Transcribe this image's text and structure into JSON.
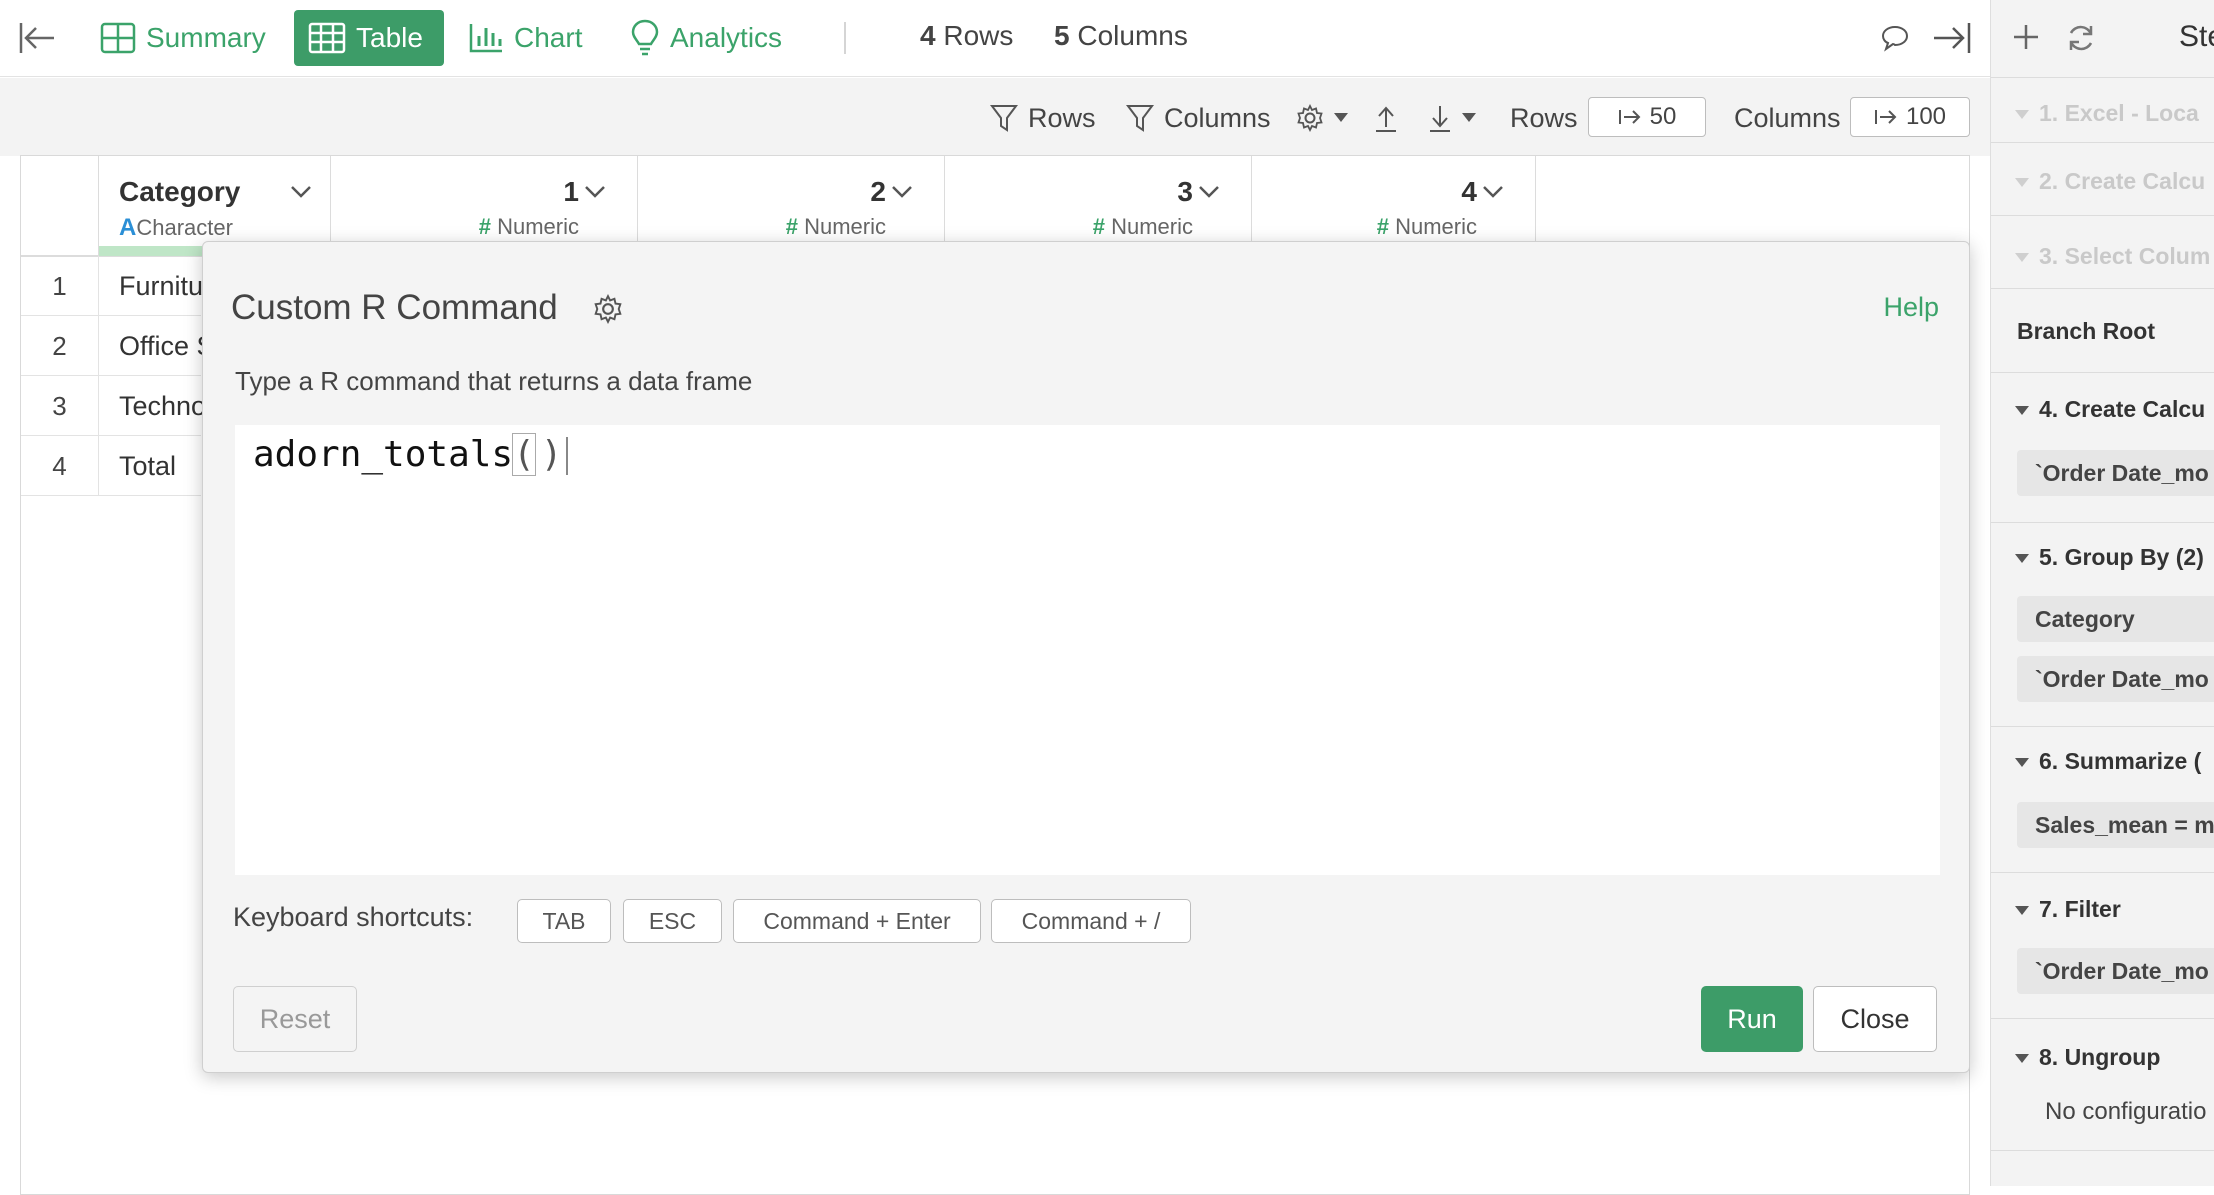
{
  "topbar": {
    "tabs": [
      {
        "label": "Summary",
        "icon": "summary-icon"
      },
      {
        "label": "Table",
        "icon": "table-icon",
        "active": true
      },
      {
        "label": "Chart",
        "icon": "chart-icon"
      },
      {
        "label": "Analytics",
        "icon": "bulb-icon"
      }
    ],
    "rows_count": "4",
    "rows_label": "Rows",
    "cols_count": "5",
    "cols_label": "Columns"
  },
  "toolbar": {
    "rows_filter": "Rows",
    "columns_filter": "Columns",
    "rows_label": "Rows",
    "rows_value": "50",
    "columns_label": "Columns",
    "columns_value": "100"
  },
  "table": {
    "columns": [
      {
        "name": "Category",
        "type": "Character",
        "type_icon": "A"
      },
      {
        "name": "1",
        "type": "Numeric",
        "type_icon": "#"
      },
      {
        "name": "2",
        "type": "Numeric",
        "type_icon": "#"
      },
      {
        "name": "3",
        "type": "Numeric",
        "type_icon": "#"
      },
      {
        "name": "4",
        "type": "Numeric",
        "type_icon": "#"
      }
    ],
    "rows": [
      {
        "num": "1",
        "category": "Furnitu"
      },
      {
        "num": "2",
        "category": "Office S"
      },
      {
        "num": "3",
        "category": "Techno"
      },
      {
        "num": "4",
        "category": "Total"
      }
    ]
  },
  "modal": {
    "title": "Custom R Command",
    "help": "Help",
    "description": "Type a R command that returns a data frame",
    "code_fn": "adorn_totals",
    "code_open": "(",
    "code_close": ")",
    "shortcuts_label": "Keyboard shortcuts:",
    "shortcuts": [
      "TAB",
      "ESC",
      "Command + Enter",
      "Command + /"
    ],
    "reset": "Reset",
    "run": "Run",
    "close": "Close"
  },
  "right_panel": {
    "header": "Ste",
    "faded_steps": [
      "1. Excel - Loca",
      "2. Create Calcu",
      "3. Select Colum"
    ],
    "branch_root": "Branch Root",
    "steps": [
      {
        "title": "4. Create Calcu",
        "chips": [
          "`Order Date_mo"
        ]
      },
      {
        "title": "5. Group By (2)",
        "chips": [
          "Category",
          "`Order Date_mo"
        ]
      },
      {
        "title": "6. Summarize (",
        "chips": [
          "Sales_mean = m"
        ]
      },
      {
        "title": "7. Filter",
        "chips": [
          "`Order Date_mo"
        ]
      },
      {
        "title": "8. Ungroup",
        "note": "No configuratio"
      }
    ]
  },
  "colors": {
    "accent": "#3d9c68",
    "accent_text": "#3ba36a",
    "character_type": "#2b8fd6"
  }
}
